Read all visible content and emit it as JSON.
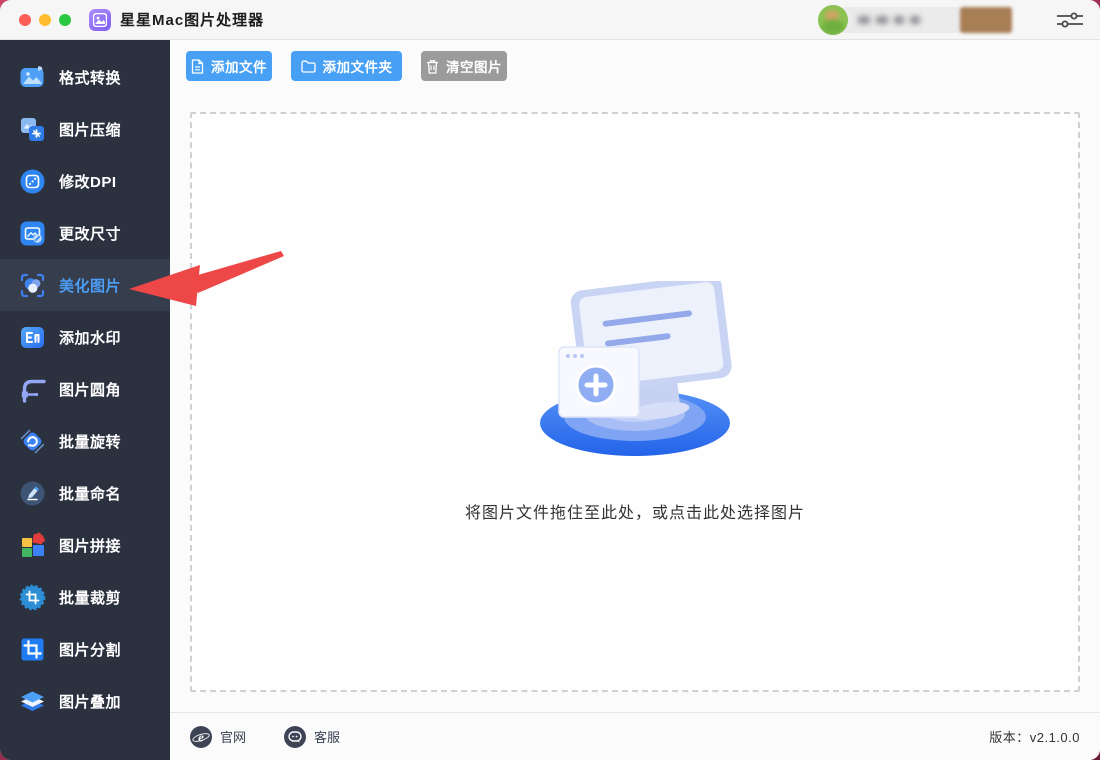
{
  "titlebar": {
    "title": "星星Mac图片处理器",
    "app_icon": "image-app-icon",
    "window_controls": [
      "close",
      "minimize",
      "zoom"
    ],
    "account_area": "redacted-user-info",
    "settings_icon": "sliders-icon"
  },
  "sidebar": {
    "items": [
      {
        "label": "格式转换",
        "icon": "format-convert-icon",
        "selected": false
      },
      {
        "label": "图片压缩",
        "icon": "image-compress-icon",
        "selected": false
      },
      {
        "label": "修改DPI",
        "icon": "modify-dpi-icon",
        "selected": false
      },
      {
        "label": "更改尺寸",
        "icon": "resize-icon",
        "selected": false
      },
      {
        "label": "美化图片",
        "icon": "beautify-image-icon",
        "selected": true
      },
      {
        "label": "添加水印",
        "icon": "watermark-icon",
        "selected": false
      },
      {
        "label": "图片圆角",
        "icon": "round-corner-icon",
        "selected": false
      },
      {
        "label": "批量旋转",
        "icon": "batch-rotate-icon",
        "selected": false
      },
      {
        "label": "批量命名",
        "icon": "batch-rename-icon",
        "selected": false
      },
      {
        "label": "图片拼接",
        "icon": "image-stitch-icon",
        "selected": false
      },
      {
        "label": "批量裁剪",
        "icon": "batch-crop-icon",
        "selected": false
      },
      {
        "label": "图片分割",
        "icon": "image-split-icon",
        "selected": false
      },
      {
        "label": "图片叠加",
        "icon": "image-overlay-icon",
        "selected": false
      }
    ]
  },
  "toolbar": {
    "add_file_label": "添加文件",
    "add_folder_label": "添加文件夹",
    "clear_images_label": "清空图片"
  },
  "dropzone": {
    "hint": "将图片文件拖住至此处，或点击此处选择图片",
    "illustration": "monitor-with-add-window-3d"
  },
  "footer": {
    "website_label": "官网",
    "support_label": "客服",
    "version": "版本：v2.1.0.0"
  },
  "annotation": {
    "type": "red-arrow",
    "points_to": "美化图片",
    "color": "#ee4747"
  },
  "colors": {
    "accent_blue": "#48a0f5",
    "sidebar_bg": "#2b313f",
    "selected_row_bg": "#363d4d",
    "selected_text": "#4c9df5",
    "gray_button": "#9b9b9b",
    "titlebar_bg": "#f6f6f6"
  }
}
